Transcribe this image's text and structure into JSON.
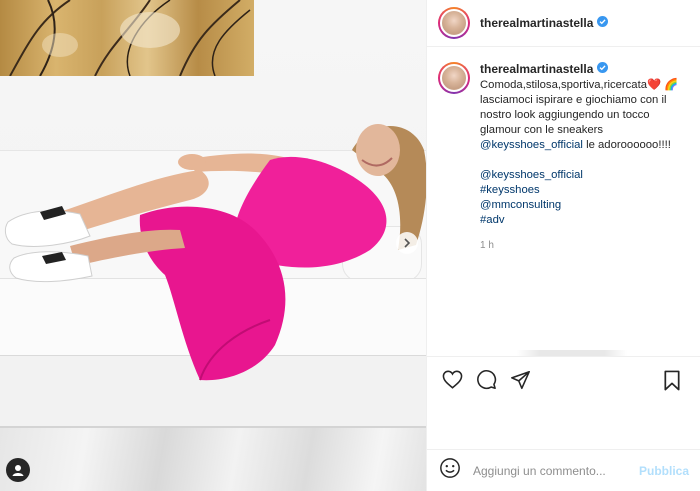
{
  "post": {
    "username": "therealmartinastella",
    "verified": true,
    "media_alt": "photo",
    "caption_lines": [
      "Comoda,stilosa,sportiva,ricercata❤️ 🌈",
      "lasciamoci ispirare e giochiamo con il",
      "nostro look aggiungendo un tocco",
      "glamour con le sneakers"
    ],
    "caption_mention": "@keysshoes_official",
    "caption_mention_suffix": " le adoroooooo!!!!",
    "tags": [
      "@keysshoes_official",
      "#keysshoes",
      "@mmconsulting",
      "#adv"
    ],
    "time_ago": "1 h"
  },
  "icons": {
    "like": "heart-icon",
    "comment": "comment-icon",
    "share": "send-icon",
    "save": "bookmark-icon",
    "emoji": "emoji-icon",
    "user_tag": "user-icon",
    "carousel": "chevron-right-icon"
  },
  "comment_box": {
    "placeholder": "Aggiungi un commento...",
    "publish_label": "Pubblica"
  },
  "colors": {
    "dress": "#f0209a",
    "link": "#00376b",
    "verified": "#3897f0",
    "publish_disabled": "#b2dffc"
  }
}
